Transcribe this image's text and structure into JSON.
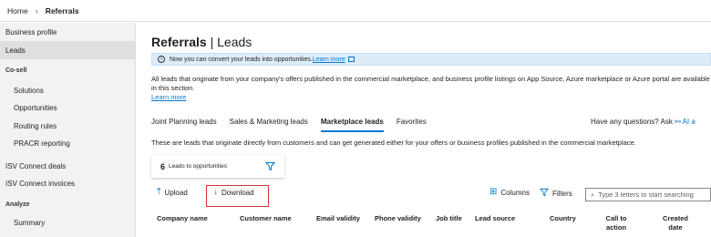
{
  "breadcrumb": {
    "home": "Home",
    "current": "Referrals"
  },
  "sidebar": {
    "items": [
      {
        "label": "Business profile"
      },
      {
        "label": "Leads"
      }
    ],
    "cosell_heading": "Co-sell",
    "cosell_items": [
      {
        "label": "Solutions"
      },
      {
        "label": "Opportunities"
      },
      {
        "label": "Routing rules"
      },
      {
        "label": "PRACR reporting"
      }
    ],
    "bottom_items": [
      {
        "label": "ISV Connect deals"
      },
      {
        "label": "ISV Connect invoices"
      }
    ],
    "analyze_heading": "Analyze",
    "analyze_items": [
      {
        "label": "Summary"
      }
    ]
  },
  "page": {
    "title_main": "Referrals",
    "title_sep": " | ",
    "title_sub": "Leads"
  },
  "info_bar": {
    "text": "Now you can convert your leads into opportunities. ",
    "link": "Learn more"
  },
  "description": {
    "text": "All leads that originate from your company's offers published in the commercial marketplace, and business profile listings on App Source, Azure marketplace or Azure portal are available in this section.",
    "link": "Learn more"
  },
  "tabs": [
    {
      "label": "Joint Planning leads",
      "active": false
    },
    {
      "label": "Sales & Marketing leads",
      "active": false
    },
    {
      "label": "Marketplace leads",
      "active": true
    },
    {
      "label": "Favorites",
      "active": false
    }
  ],
  "help": {
    "text": "Have any questions? Ask ",
    "link": "AI a"
  },
  "tab_description": "These are leads that originate directly from customers and can get generated either for your offers or business profiles published in the commercial marketplace.",
  "summary_card": {
    "count": "6",
    "label": "Leads to opportunities"
  },
  "toolbar": {
    "upload_label": "Upload",
    "download_label": "Download",
    "columns_label": "Columns",
    "filters_label": "Filters",
    "search_placeholder": "Type 3 letters to start searching"
  },
  "table": {
    "columns": [
      "Company name",
      "Customer name",
      "Email validity",
      "Phone validity",
      "Job title",
      "Lead source",
      "Country",
      "Call to action",
      "Created date"
    ]
  },
  "colors": {
    "accent": "#0078d4",
    "highlight": "#d13438",
    "info_bg": "#deecf9",
    "sidebar_bg": "#f3f2f1"
  }
}
